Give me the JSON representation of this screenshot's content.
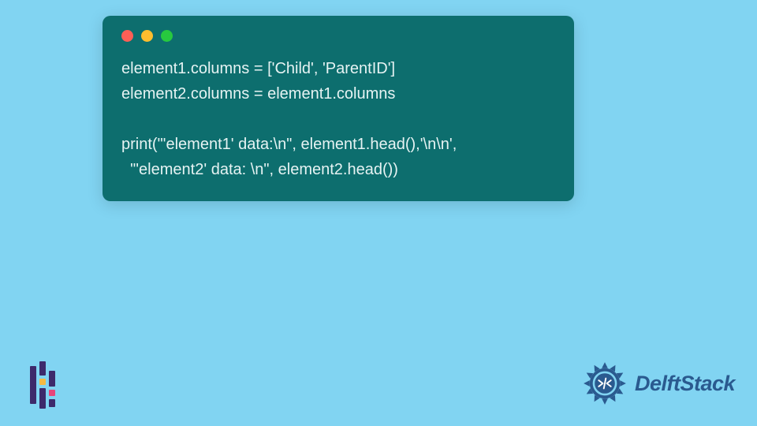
{
  "code": {
    "line1": "element1.columns = ['Child', 'ParentID']",
    "line2": "element2.columns = element1.columns",
    "line3": "",
    "line4": "print(\"'element1' data:\\n\", element1.head(),'\\n\\n',",
    "line5": "  \"'element2' data: \\n\", element2.head())"
  },
  "brand": {
    "name": "DelftStack"
  },
  "colors": {
    "background": "#81d4f2",
    "window": "#0d6e6e",
    "code_text": "#e6f3f3",
    "traffic_red": "#ff5f56",
    "traffic_yellow": "#ffbd2e",
    "traffic_green": "#27c93f",
    "brand_blue": "#2a5a8f",
    "logo_purple": "#3d2a6b",
    "logo_yellow": "#f5b942",
    "logo_pink": "#e8457a"
  }
}
